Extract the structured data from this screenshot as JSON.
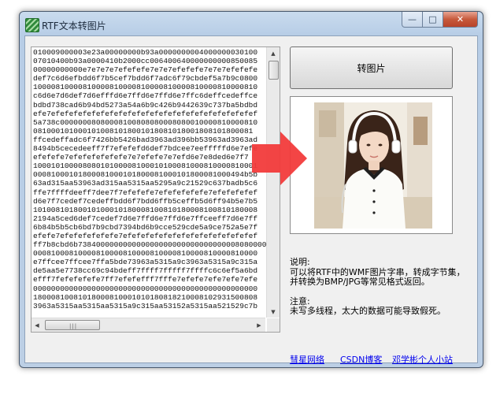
{
  "window": {
    "title": "RTF文本转图片",
    "min_glyph": "—",
    "max_glyph": "□",
    "close_glyph": "✕"
  },
  "hex_lines": [
    "010009000003e23a00000000b93a0000000004000000030100",
    "07010400b93a0000410b2000cc006400640000000000850085",
    "00000000000e7e7e7e7efefefe7e7e7efefefe7e7e7efefefe",
    "def7c6d6efbdd6f7b5cef7bdd6f7adc6f79cbdef5a7b9c0800",
    "10000810000810000810000810000810000810000810000810",
    "c6d6e7d6def7d6efffd6e7ffd6e7ffd6e7ffc6deffcedeffce",
    "bdbd738cad6b94bd5273a54a6b9c426b9442639c737ba5bdbd",
    "efe7efefefefefefefefefefefefefefefefefefefefefefef",
    "5a738c00000008080008100808080008080010000810000810",
    "0810001010001010081018001018081018001808101800081",
    "ffcedeffadc6f7426bb5426bad3963ad396bb53963ad3963ad",
    "8494b5cecedeeff7f7efefefd6def7bdcee7eefffffd6e7efe",
    "efefefe7efefefefefefe7e7efefe7e7efd6e7e8ded6e7f7",
    "10001010000808010100008100010100081000810000810001",
    "00081000101800081000101800081000101800081000494b5b",
    "63ad315aa53963ad315aa5315aa5295a9c21529c637badb5c6",
    "ffe7ffffdeeff7dee7f7efefefe7efefefefefe7efefefefef",
    "d6e7f7cedef7cedeffbdd6f7bdd6ffb5ceffb5d6ff94b5e7b5",
    "10100810180010100010180008100810180008100810180008",
    "2194a5ced6def7cedef7d6e7ffd6e7ffd6e7ffceeff7d6e7ff",
    "6b84b5b5cb6bd7b9cbd7394bd6b9cce529cde5a9ce752a5e7f",
    "efefe7efefefefefefe7efefefefefefefefefefefefefefef",
    "ff7b8cbd6b738400000000000000000000000000000008080000",
    "00081000810000810000810000810000810000810000810000",
    "e7ffcee7ffcee7ffa5bde73963a5315a9c3963a5315a9c315a",
    "de5aa5e7738cc69c94bdeff7ffff7fffff7ffffc6c6ef5a6bd",
    "efff7fefefefefe7ff7efefefff7fffe7efefe7efe7efe7efe",
    "00000000000000000000000000000000000000000000000000",
    "18000810081018000810001010180818210008102931500808",
    "3963a5315aa5315aa5315a9c315aa53152a5315aa521529c7b"
  ],
  "convert_button_label": "转图片",
  "info": {
    "notes_heading": "说明:",
    "notes_text": "可以将RTF中的WMF图片字串，转成字节集，并转换为BMP/JPG等常见格式返回。",
    "caution_heading": "注意:",
    "caution_text": "未写多线程，太大的数据可能导致假死。"
  },
  "links": [
    "彗星网络",
    "CSDN博客",
    "邓学彬个人小站"
  ],
  "colors": {
    "arrow": "#f23b3b",
    "link": "#0000ee"
  },
  "icons": [
    "app-icon",
    "up-arrow-icon",
    "down-arrow-icon",
    "left-arrow-icon",
    "right-arrow-icon",
    "big-right-arrow-icon"
  ]
}
